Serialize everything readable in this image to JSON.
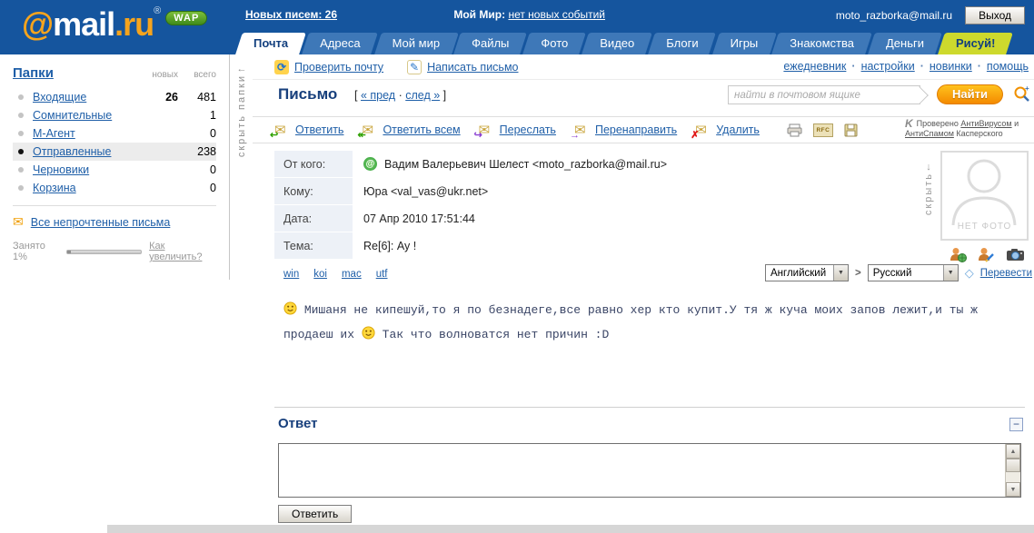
{
  "topbar": {
    "logo_at": "@",
    "logo_mail": "mail",
    "logo_ru": ".ru",
    "logo_reg": "®",
    "wap_badge": "WAP",
    "new_mail_link": "Новых писем: 26",
    "my_world_label": "Мой Мир:",
    "my_world_link": "нет новых событий",
    "user_email": "moto_razborka@mail.ru",
    "logout_button": "Выход"
  },
  "tabs": [
    {
      "label": "Почта"
    },
    {
      "label": "Адреса"
    },
    {
      "label": "Мой мир"
    },
    {
      "label": "Файлы"
    },
    {
      "label": "Фото"
    },
    {
      "label": "Видео"
    },
    {
      "label": "Блоги"
    },
    {
      "label": "Игры"
    },
    {
      "label": "Знакомства"
    },
    {
      "label": "Деньги"
    },
    {
      "label": "Рисуй!"
    }
  ],
  "sidebar": {
    "title": "Папки",
    "col_new": "новых",
    "col_total": "всего",
    "folders": [
      {
        "label": "Входящие",
        "new": "26",
        "total": "481"
      },
      {
        "label": "Сомнительные",
        "new": "",
        "total": "1"
      },
      {
        "label": "М-Агент",
        "new": "",
        "total": "0"
      },
      {
        "label": "Отправленные",
        "new": "",
        "total": "238"
      },
      {
        "label": "Черновики",
        "new": "",
        "total": "0"
      },
      {
        "label": "Корзина",
        "new": "",
        "total": "0"
      }
    ],
    "unread_link": "Все непрочтенные письма",
    "quota_label": "Занято 1%",
    "quota_link": "Как увеличить?",
    "collapse_arrow": "←",
    "collapse_label": "скрыть папки"
  },
  "toolbar": {
    "check_mail": "Проверить почту",
    "compose": "Написать письмо",
    "links": [
      "ежедневник",
      "настройки",
      "новинки",
      "помощь"
    ]
  },
  "letter": {
    "title": "Письмо",
    "bracket_open": "[",
    "prev_link": "« пред",
    "dot": "·",
    "next_link": "след »",
    "bracket_close": "]"
  },
  "search": {
    "placeholder": "найти в почтовом ящике",
    "button": "Найти"
  },
  "actions": {
    "reply": "Ответить",
    "reply_all": "Ответить всем",
    "forward": "Переслать",
    "redirect": "Перенаправить",
    "delete": "Удалить",
    "rfc_label": "RFC",
    "checked": "Проверено",
    "antivirus": "АнтиВирусом",
    "and": "и",
    "antispam": "АнтиСпамом",
    "kaspersky": "Касперского"
  },
  "message": {
    "from_label": "От кого:",
    "from_value": "Вадим Валерьевич Шелест <moto_razborka@mail.ru>",
    "to_label": "Кому:",
    "to_value": "Юра <val_vas@ukr.net>",
    "date_label": "Дата:",
    "date_value": "07 Апр 2010 17:51:44",
    "subject_label": "Тема:",
    "subject_value": "Re[6]: Ау !",
    "encodings": [
      "win",
      "koi",
      "mac",
      "utf"
    ],
    "lang_from": "Английский",
    "lang_to": "Русский",
    "translate_link": "Перевести",
    "body_line1": "Мишаня не кипешуй,то я по безнадеге,все равно хер кто купит.У тя ж куча моих запов лежит,и ты ж",
    "body_line2_pre": "продаеш их",
    "body_line2_post": "Так что волноватся нет причин :D"
  },
  "photo": {
    "no_photo": "НЕТ ФОТО",
    "hide_arrow": "↓",
    "hide_label": "скрыть"
  },
  "reply": {
    "title": "Ответ",
    "minimize": "−",
    "submit": "Ответить"
  }
}
